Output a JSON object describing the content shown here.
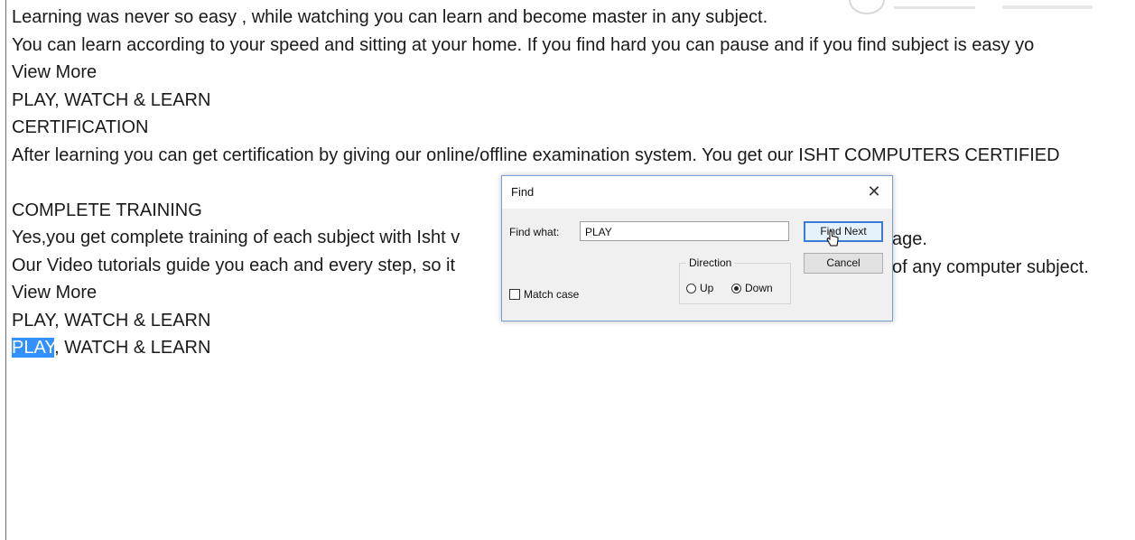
{
  "document": {
    "lines": [
      "Learning was never so easy , while watching you can learn and become master in any subject.",
      "You can learn according to your speed and sitting at your home. If you find hard you can pause and if you find subject is easy yo",
      "View More",
      "PLAY, WATCH & LEARN",
      "CERTIFICATION",
      "After learning you can get certification by giving our online/offline examination system. You get our ISHT COMPUTERS CERTIFIED",
      "",
      "COMPLETE TRAINING",
      "Yes,you get complete training of each subject with Isht v",
      "Our Video tutorials guide you each and every step, so it",
      "View More",
      "PLAY, WATCH & LEARN"
    ],
    "line8_tail": "age.",
    "line9_tail": "of any computer subject.",
    "last_line_highlight": "PLAY",
    "last_line_rest": ", WATCH & LEARN"
  },
  "find_dialog": {
    "title": "Find",
    "close_glyph": "✕",
    "find_what_label": "Find what:",
    "find_what_value": "PLAY",
    "find_next_label": "Find Next",
    "cancel_label": "Cancel",
    "direction_label": "Direction",
    "up_label": "Up",
    "down_label": "Down",
    "direction_selected": "Down",
    "match_case_label": "Match case",
    "match_case_checked": false
  },
  "colors": {
    "highlight": "#3390ff",
    "dialog_border": "#7a9fd2",
    "default_button_border": "#3a7bd5"
  }
}
